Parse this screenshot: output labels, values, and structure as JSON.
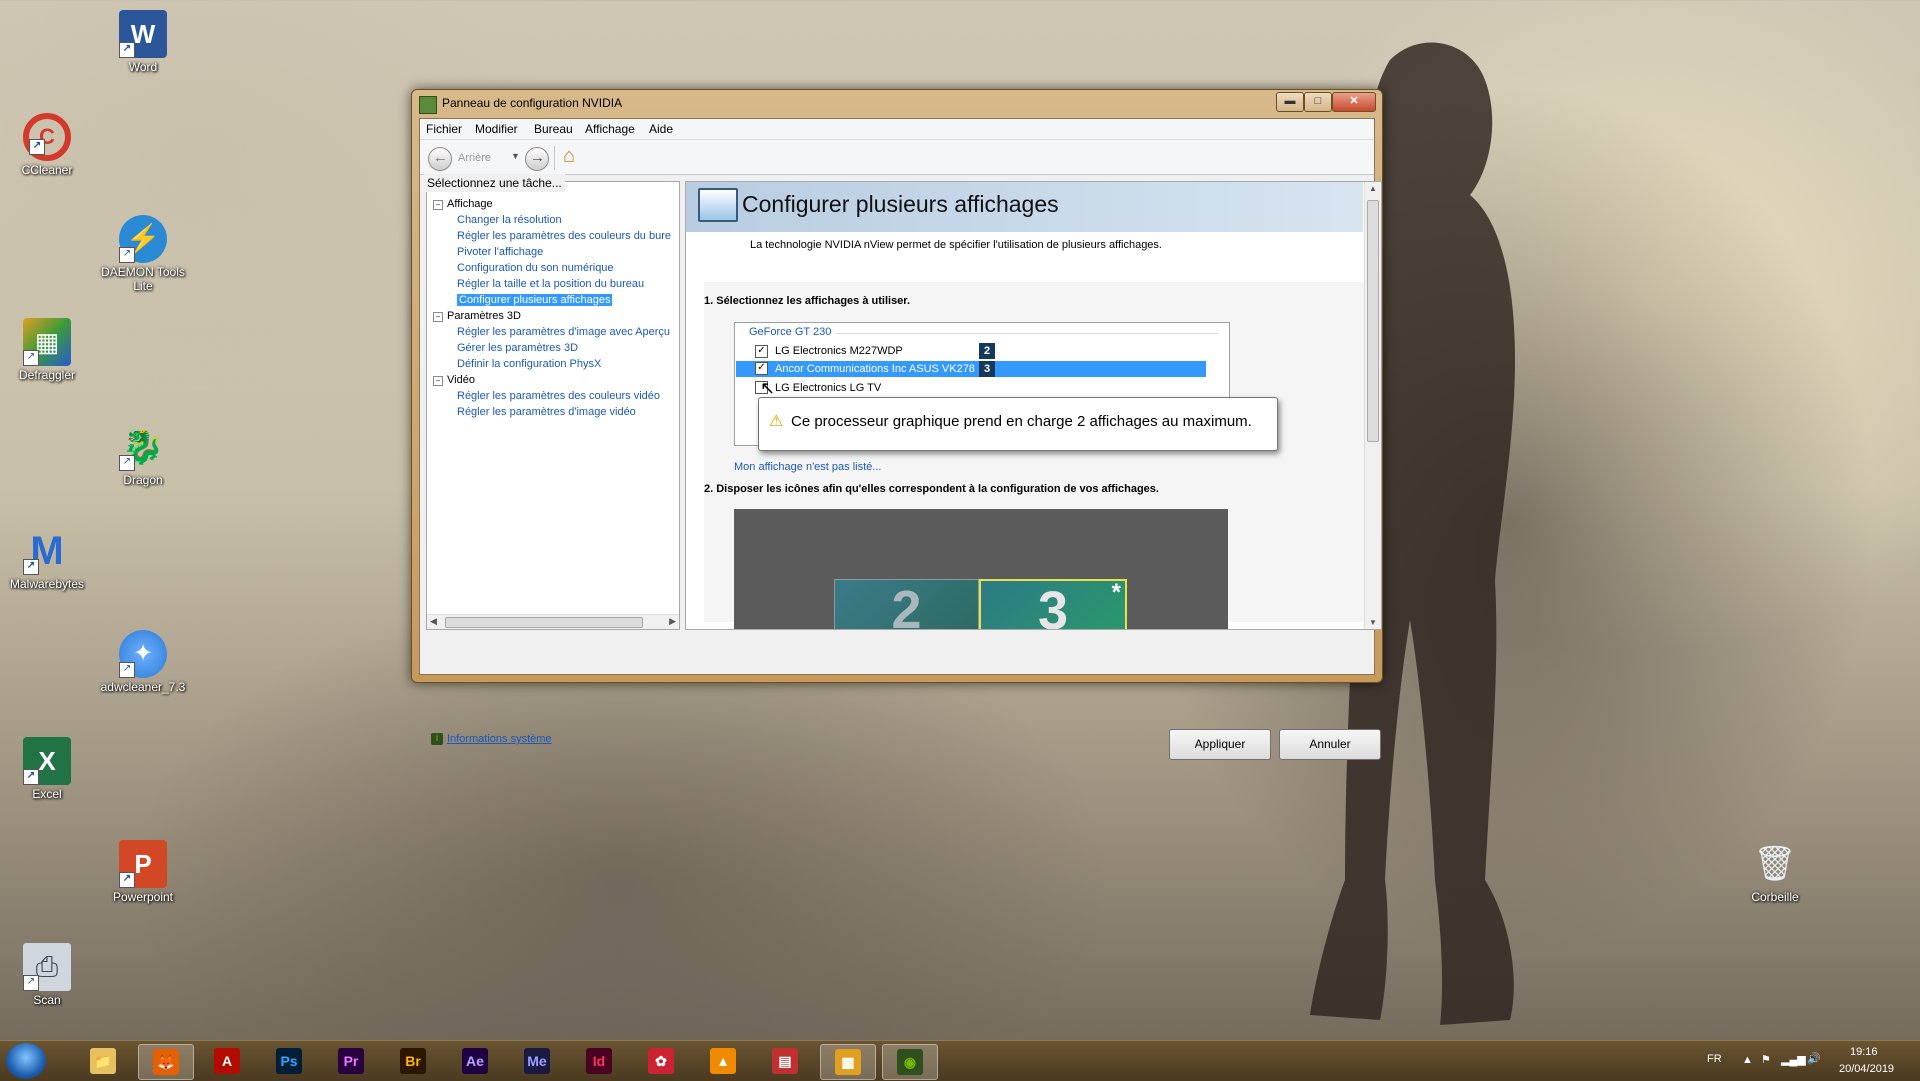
{
  "desktop": {
    "icons": [
      {
        "label": "Word",
        "glyph": "W",
        "color": "#2b579a"
      },
      {
        "label": "CCleaner",
        "glyph": "C",
        "color": "#d33a2c"
      },
      {
        "label": "DAEMON Tools Lite",
        "glyph": "⚡",
        "color": "#2a8ad6"
      },
      {
        "label": "Defraggler",
        "glyph": "▦",
        "color": "#e0a020"
      },
      {
        "label": "Dragon",
        "glyph": "🐉",
        "color": "#dddddd"
      },
      {
        "label": "Malwarebytes",
        "glyph": "M",
        "color": "#2a6bd1"
      },
      {
        "label": "adwcleaner_7.3",
        "glyph": "✦",
        "color": "#2a7bd6"
      },
      {
        "label": "Excel",
        "glyph": "X",
        "color": "#217346"
      },
      {
        "label": "Powerpoint",
        "glyph": "P",
        "color": "#d24726"
      },
      {
        "label": "Scan",
        "glyph": "⎙",
        "color": "#8899aa"
      },
      {
        "label": "Corbeille",
        "glyph": "🗑",
        "color": "#cfd8e0"
      }
    ]
  },
  "window": {
    "title": "Panneau de configuration NVIDIA",
    "controls": {
      "minimize": "▬",
      "maximize": "□",
      "close": "✕"
    },
    "menu": [
      "Fichier",
      "Modifier",
      "Bureau",
      "Affichage",
      "Aide"
    ],
    "toolbar": {
      "back_label": "Arrière"
    },
    "sidebar": {
      "heading": "Sélectionnez une tâche...",
      "tree": [
        {
          "label": "Affichage",
          "level": 0,
          "type": "group"
        },
        {
          "label": "Changer la résolution",
          "level": 1,
          "type": "link"
        },
        {
          "label": "Régler les paramètres des couleurs du bure",
          "level": 1,
          "type": "link"
        },
        {
          "label": "Pivoter l'affichage",
          "level": 1,
          "type": "link"
        },
        {
          "label": "Configuration du son numérique",
          "level": 1,
          "type": "link"
        },
        {
          "label": "Régler la taille et la position du bureau",
          "level": 1,
          "type": "link"
        },
        {
          "label": "Configurer plusieurs affichages",
          "level": 1,
          "type": "selected"
        },
        {
          "label": "Paramètres 3D",
          "level": 0,
          "type": "group"
        },
        {
          "label": "Régler les paramètres d'image avec Aperçu",
          "level": 1,
          "type": "link"
        },
        {
          "label": "Gérer les paramètres 3D",
          "level": 1,
          "type": "link"
        },
        {
          "label": "Définir la configuration PhysX",
          "level": 1,
          "type": "link"
        },
        {
          "label": "Vidéo",
          "level": 0,
          "type": "group"
        },
        {
          "label": "Régler les paramètres des couleurs vidéo",
          "level": 1,
          "type": "link"
        },
        {
          "label": "Régler les paramètres d'image vidéo",
          "level": 1,
          "type": "link"
        }
      ]
    },
    "main": {
      "title": "Configurer plusieurs affichages",
      "description": "La technologie NVIDIA nView permet de spécifier l'utilisation de plusieurs affichages.",
      "step1": "1. Sélectionnez les affichages à utiliser.",
      "gpu_name": "GeForce GT 230",
      "displays": [
        {
          "name": "LG Electronics M227WDP",
          "checked": true,
          "badge": "2",
          "selected": false
        },
        {
          "name": "Ancor Communications Inc ASUS VK278",
          "checked": true,
          "badge": "3",
          "selected": true
        },
        {
          "name": "LG Electronics LG TV",
          "checked": false,
          "badge": "",
          "selected": false
        }
      ],
      "tooltip": "Ce processeur graphique prend en charge 2 affichages au maximum.",
      "not_listed_link": "Mon affichage n'est pas listé...",
      "step2": "2. Disposer les icônes afin qu'elles correspondent à la configuration de vos affichages.",
      "arrange": {
        "monitor_a": "2",
        "monitor_b": "3",
        "primary_marker": "*"
      }
    },
    "footer": {
      "system_info": "Informations système",
      "apply": "Appliquer",
      "cancel": "Annuler"
    }
  },
  "taskbar": {
    "apps": [
      {
        "name": "Explorer",
        "glyph": "📁",
        "bg": "#e8c060",
        "fg": "#000"
      },
      {
        "name": "Firefox",
        "glyph": "🦊",
        "bg": "#e66000",
        "fg": "#fff"
      },
      {
        "name": "Acrobat",
        "glyph": "A",
        "bg": "#b30b00",
        "fg": "#fff"
      },
      {
        "name": "Photoshop",
        "glyph": "Ps",
        "bg": "#001e36",
        "fg": "#31a8ff"
      },
      {
        "name": "Premiere",
        "glyph": "Pr",
        "bg": "#2a003f",
        "fg": "#e77bff"
      },
      {
        "name": "Bridge",
        "glyph": "Br",
        "bg": "#2b1600",
        "fg": "#ffb400"
      },
      {
        "name": "After Effects",
        "glyph": "Ae",
        "bg": "#1f0040",
        "fg": "#b8a6ff"
      },
      {
        "name": "Media Encoder",
        "glyph": "Me",
        "bg": "#1a1a40",
        "fg": "#9aa0ff"
      },
      {
        "name": "InDesign",
        "glyph": "Id",
        "bg": "#49021f",
        "fg": "#ff3366"
      },
      {
        "name": "Sparkle",
        "glyph": "✿",
        "bg": "#cc2233",
        "fg": "#fff"
      },
      {
        "name": "VLC",
        "glyph": "▲",
        "bg": "#f08a00",
        "fg": "#fff"
      },
      {
        "name": "Toolbox",
        "glyph": "▤",
        "bg": "#c03030",
        "fg": "#fff"
      },
      {
        "name": "Defraggler",
        "glyph": "▦",
        "bg": "#e0a020",
        "fg": "#fff"
      },
      {
        "name": "NVIDIA",
        "glyph": "◉",
        "bg": "#2f4f1c",
        "fg": "#76b900"
      }
    ],
    "tray": {
      "lang": "FR",
      "time": "19:16",
      "date": "20/04/2019"
    }
  }
}
